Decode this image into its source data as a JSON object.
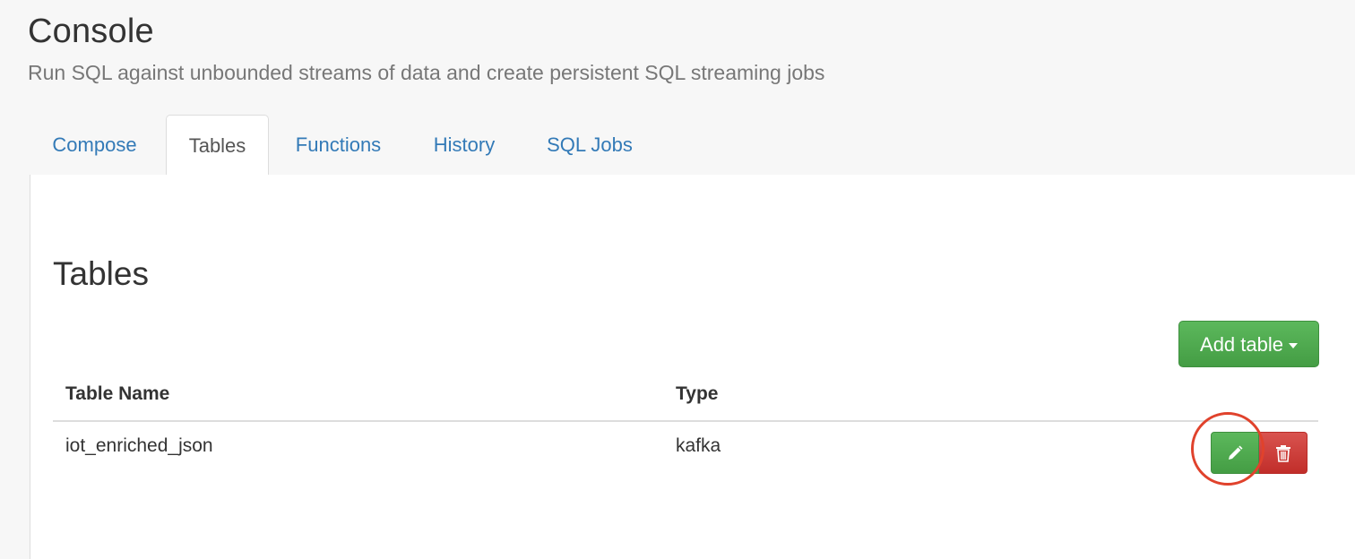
{
  "header": {
    "title": "Console",
    "subtitle": "Run SQL against unbounded streams of data and create persistent SQL streaming jobs"
  },
  "tabs": [
    {
      "label": "Compose",
      "active": false
    },
    {
      "label": "Tables",
      "active": true
    },
    {
      "label": "Functions",
      "active": false
    },
    {
      "label": "History",
      "active": false
    },
    {
      "label": "SQL Jobs",
      "active": false
    }
  ],
  "tables_section": {
    "title": "Tables",
    "add_table_label": "Add table",
    "columns": [
      "Table Name",
      "Type"
    ],
    "rows": [
      {
        "name": "iot_enriched_json",
        "type": "kafka"
      }
    ]
  },
  "icons": {
    "edit": "pencil-icon",
    "delete": "trash-icon",
    "dropdown": "caret-down-icon"
  },
  "colors": {
    "link": "#337ab7",
    "success": "#5cb85c",
    "danger": "#d9534f",
    "highlight": "#e0422c"
  }
}
